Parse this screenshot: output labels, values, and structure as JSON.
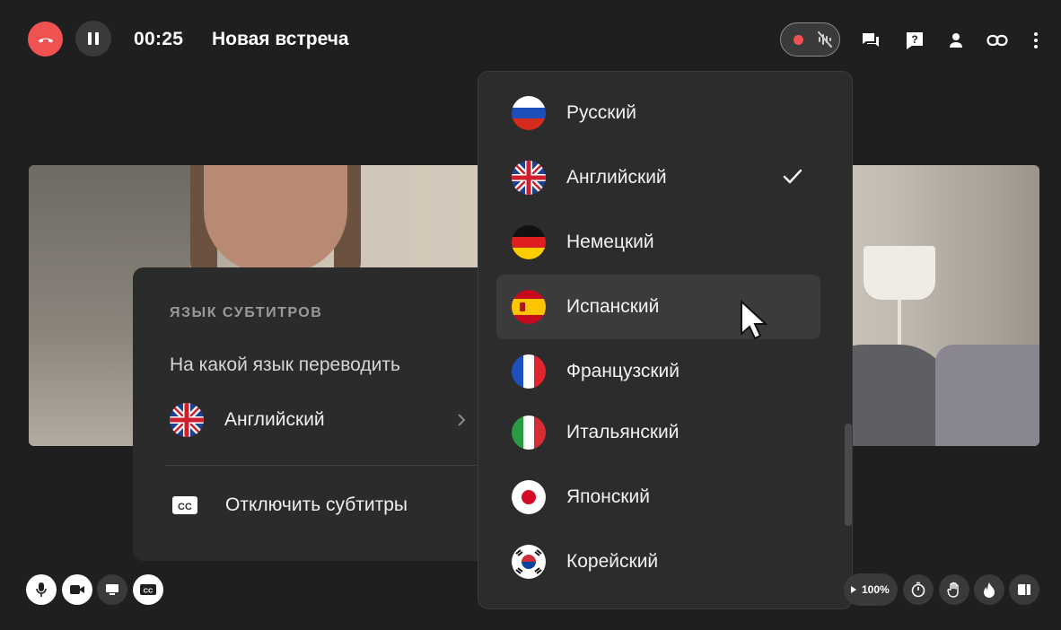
{
  "header": {
    "timer": "00:25",
    "title": "Новая встреча"
  },
  "subtitles_panel": {
    "heading": "ЯЗЫК СУБТИТРОВ",
    "question": "На какой язык переводить",
    "selected_language": "Английский",
    "disable_label": "Отключить субтитры"
  },
  "language_menu": {
    "items": [
      {
        "label": "Русский",
        "flag": "russia-flag-icon"
      },
      {
        "label": "Английский",
        "flag": "uk-flag-icon",
        "selected": true
      },
      {
        "label": "Немецкий",
        "flag": "germany-flag-icon"
      },
      {
        "label": "Испанский",
        "flag": "spain-flag-icon",
        "hovered": true
      },
      {
        "label": "Французский",
        "flag": "france-flag-icon"
      },
      {
        "label": "Итальянский",
        "flag": "italy-flag-icon"
      },
      {
        "label": "Японский",
        "flag": "japan-flag-icon"
      },
      {
        "label": "Корейский",
        "flag": "korea-flag-icon"
      }
    ]
  },
  "bottom_bar": {
    "playback_speed": "100%"
  },
  "colors": {
    "hangup": "#f05252",
    "record": "#f05252",
    "background": "#1f1f1f",
    "panel": "#2b2b2b"
  }
}
